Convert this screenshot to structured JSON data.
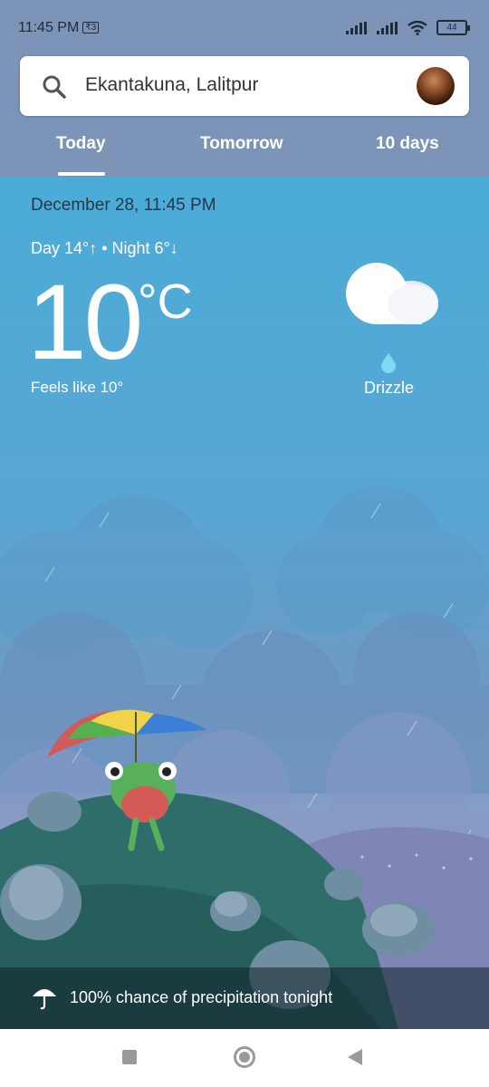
{
  "status_bar": {
    "time": "11:45 PM",
    "badge": "₹3",
    "battery": "44",
    "icons": [
      "signal-icon",
      "signal-icon",
      "wifi-icon",
      "battery-icon"
    ]
  },
  "search": {
    "location": "Ekantakuna, Lalitpur",
    "icon": "search-icon"
  },
  "tabs": [
    {
      "label": "Today"
    },
    {
      "label": "Tomorrow"
    },
    {
      "label": "10 days"
    }
  ],
  "selected_tab": "Today",
  "weather": {
    "datetime": "December 28, 11:45 PM",
    "day_night": "Day 14°↑ • Night 6°↓",
    "temperature": "10",
    "unit": "°C",
    "feels_like": "Feels like 10°",
    "condition": "Drizzle",
    "condition_icon": "cloud-icon"
  },
  "precipitation": {
    "text": "100% chance of precipitation tonight",
    "icon": "umbrella-icon"
  },
  "nav": {
    "icons": [
      "recent-apps-icon",
      "home-icon",
      "back-icon"
    ]
  }
}
